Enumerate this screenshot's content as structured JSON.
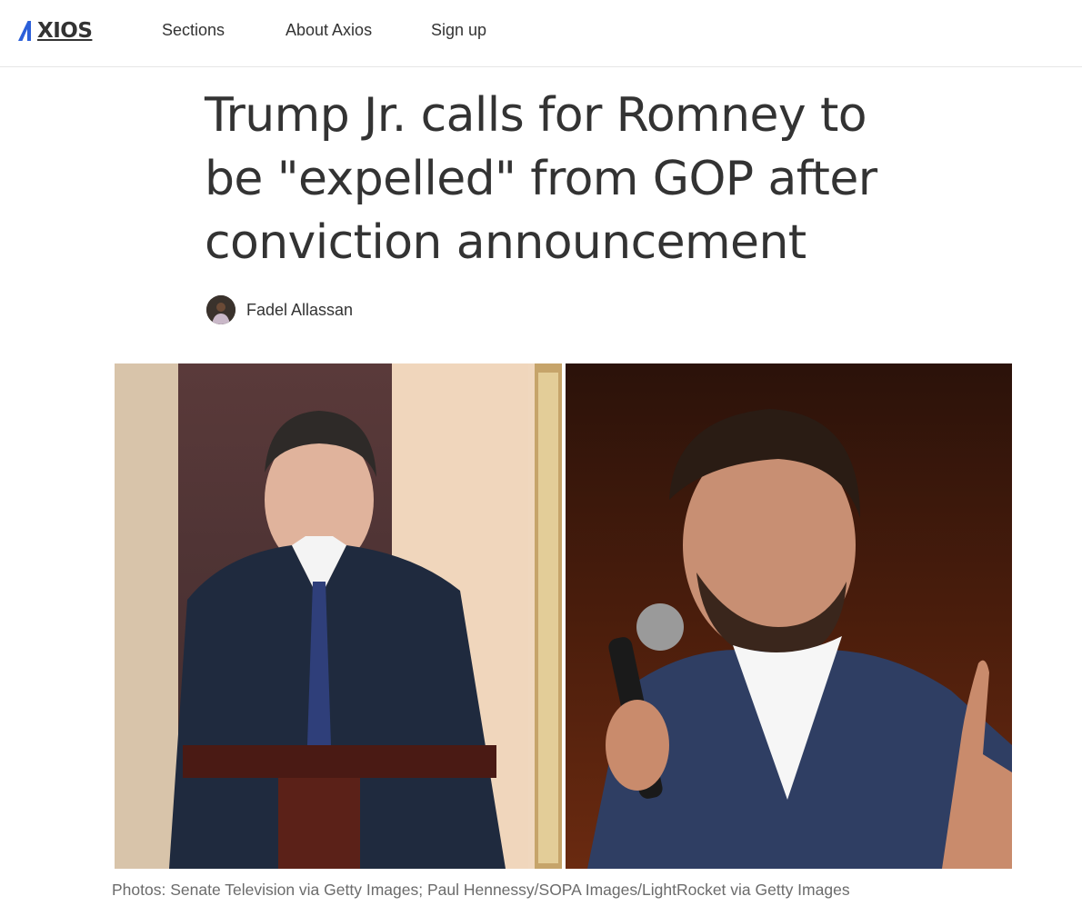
{
  "header": {
    "logo_text": "XIOS",
    "logo_aria": "AXIOS",
    "nav": [
      {
        "label": "Sections"
      },
      {
        "label": "About Axios"
      },
      {
        "label": "Sign up"
      }
    ]
  },
  "article": {
    "headline_lines": [
      "Trump Jr. calls for Romney to",
      "be \"expelled\" from GOP after",
      "conviction announcement"
    ],
    "author": "Fadel Allassan",
    "photo_caption": "Photos: Senate Television via Getty Images; Paul Hennessy/SOPA Images/LightRocket via Getty Images"
  },
  "colors": {
    "brand_blue": "#2b5fd9",
    "text": "#333333",
    "caption": "#6b6b6b",
    "divider": "#e6e6e6"
  }
}
